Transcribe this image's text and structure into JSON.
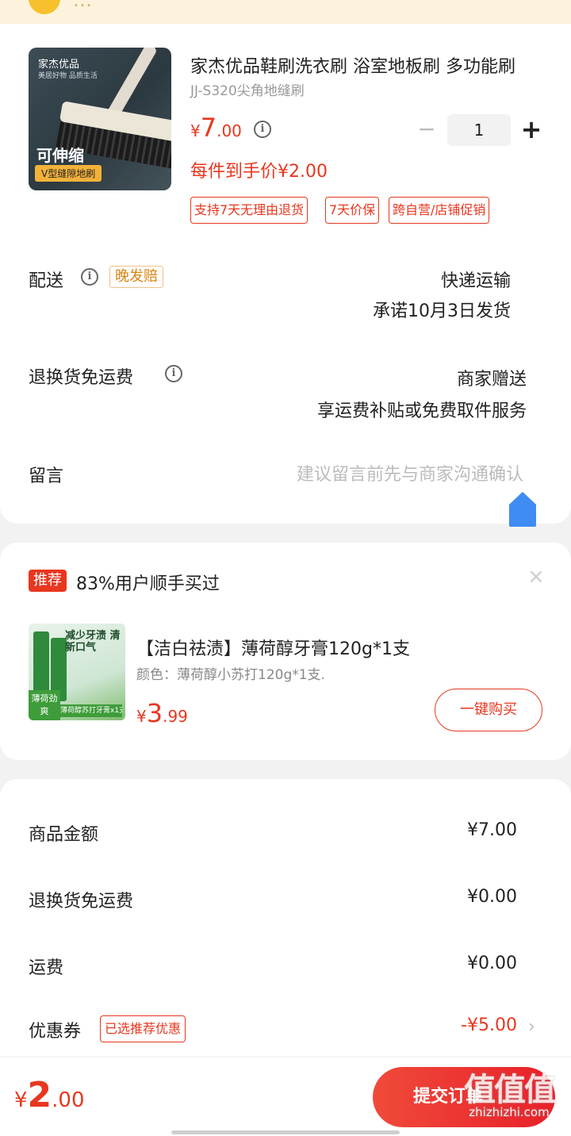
{
  "banner": {
    "text": "…"
  },
  "product": {
    "brand_on_image": "家杰优品",
    "brand_sub_on_image": "美居好物 品质生活",
    "image_tag_main": "可伸缩",
    "image_tag_sub": "V型缝隙地刷",
    "title": "家杰优品鞋刷洗衣刷 浴室地板刷 多功能刷",
    "spec": "JJ-S320尖角地缝刷",
    "price_currency": "¥",
    "price_int": "7",
    "price_dec": ".00",
    "quantity": "1",
    "minus_label": "−",
    "plus_label": "+",
    "each_price": "每件到手价¥2.00",
    "service_tags": [
      "支持7天无理由退货",
      "7天价保",
      "跨自营/店铺促销"
    ]
  },
  "delivery": {
    "label": "配送",
    "late_tag": "晚发赔",
    "method": "快递运输",
    "promise": "承诺10月3日发货"
  },
  "return_shipping": {
    "label": "退换货免运费",
    "provider": "商家赠送",
    "desc": "享运费补贴或免费取件服务"
  },
  "message": {
    "label": "留言",
    "placeholder": "建议留言前先与商家沟通确认"
  },
  "recommendation": {
    "badge": "推荐",
    "title": "83%用户顺手买过",
    "close": "×",
    "image_slogan": "减少牙渍 清新口气",
    "image_corner": "薄荷劲爽",
    "image_strip": "薄荷醇苏打牙膏x1支",
    "name": "【洁白祛渍】薄荷醇牙膏120g*1支",
    "spec": "颜色：薄荷醇小苏打120g*1支.",
    "price_currency": "¥",
    "price_int": "3",
    "price_dec": ".99",
    "buy_label": "一键购买"
  },
  "summary": {
    "rows": [
      {
        "label": "商品金额",
        "value": "¥7.00"
      },
      {
        "label": "退换货免运费",
        "value": "¥0.00"
      },
      {
        "label": "运费",
        "value": "¥0.00"
      },
      {
        "label": "优惠券",
        "value": "-¥5.00"
      }
    ],
    "coupon_tag": "已选推荐优惠",
    "arrow": "›"
  },
  "bottom": {
    "currency": "¥",
    "total_int": "2",
    "total_dec": ".00",
    "submit_label": "提交订单",
    "watermark_big": "值值值",
    "watermark_small": "zhizhizhi.com"
  },
  "colors": {
    "accent": "#e8371f",
    "late_tag": "#d98413",
    "page_bg": "#f2f2f2"
  }
}
